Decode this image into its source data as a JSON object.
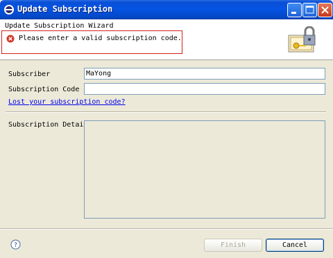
{
  "window": {
    "title": "Update Subscription",
    "app_icon": "eclipse-icon",
    "controls": [
      "minimize-icon",
      "maximize-icon",
      "close-icon"
    ]
  },
  "header": {
    "wizard_title": "Update Subscription Wizard",
    "error_message": "Please enter a valid subscription code.",
    "error_icon": "error-icon",
    "banner_icon": "lock-key-icon"
  },
  "form": {
    "subscriber_label": "Subscriber",
    "subscriber_value": "MaYong",
    "code_label": "Subscription Code",
    "code_value": "",
    "lost_code_link": "Lost your subscription code?",
    "detail_label": "Subscription Detail"
  },
  "footer": {
    "help_icon": "help-icon",
    "finish_label": "Finish",
    "cancel_label": "Cancel"
  },
  "colors": {
    "titlebar": "#0554e3",
    "error_border": "#d12020",
    "link": "#0000ee",
    "dialog_bg": "#ece9d8"
  }
}
